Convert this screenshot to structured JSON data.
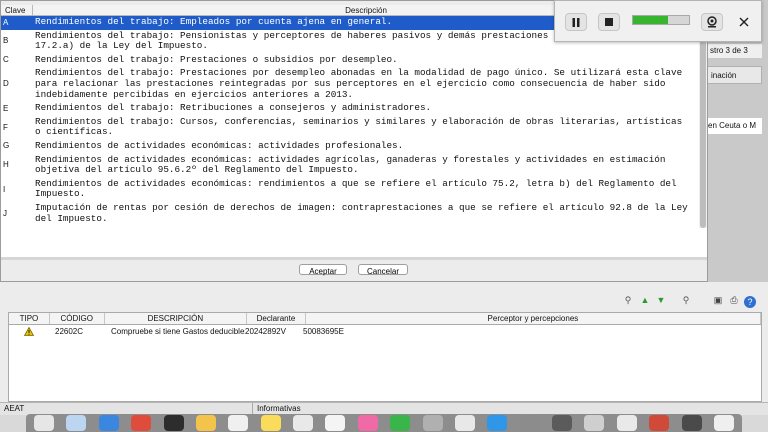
{
  "dialog": {
    "header": {
      "key": "Clave",
      "description": "Descripción"
    },
    "rows": [
      {
        "key": "A",
        "text": "Rendimientos del trabajo: Empleados por cuenta ajena en general.",
        "selected": true
      },
      {
        "key": "B",
        "text": "Rendimientos del trabajo: Pensionistas y perceptores de haberes pasivos y demás prestaciones previstas en el artículo 17.2.a) de la Ley del Impuesto."
      },
      {
        "key": "C",
        "text": "Rendimientos del trabajo: Prestaciones o subsidios por desempleo."
      },
      {
        "key": "D",
        "text": "Rendimientos del trabajo: Prestaciones por desempleo abonadas en la modalidad de pago único. Se utilizará esta clave para relacionar las prestaciones reintegradas por sus perceptores en el ejercicio como consecuencia de haber sido indebidamente percibidas en ejercicios anteriores a 2013."
      },
      {
        "key": "E",
        "text": "Rendimientos del trabajo: Retribuciones a consejeros y administradores."
      },
      {
        "key": "F",
        "text": "Rendimientos del trabajo: Cursos, conferencias, seminarios y similares y elaboración de obras literarias, artísticas o científicas."
      },
      {
        "key": "G",
        "text": "Rendimientos de actividades económicas: actividades profesionales."
      },
      {
        "key": "H",
        "text": "Rendimientos de actividades económicas: actividades agrícolas, ganaderas y forestales y actividades en estimación objetiva del artículo 95.6.2º del Reglamento del Impuesto."
      },
      {
        "key": "I",
        "text": "Rendimientos de actividades económicas: rendimientos a que se refiere el artículo 75.2, letra b) del Reglamento del Impuesto."
      },
      {
        "key": "J",
        "text": "Imputación de rentas por cesión de derechos de imagen: contraprestaciones a que se refiere el artículo 92.8 de la Ley del Impuesto."
      }
    ],
    "accept_label": "Aceptar",
    "cancel_label": "Cancelar"
  },
  "background": {
    "record_counter": "stro 3 de 3",
    "tab_label": "inación",
    "ceuta_text": "en Ceuta o M",
    "statusbar_left": "AEAT",
    "statusbar_center": "Informativas"
  },
  "results": {
    "columns": [
      "TIPO",
      "CÓDIGO",
      "DESCRIPCIÓN",
      "Declarante",
      "Perceptor y percepciones"
    ],
    "rows": [
      {
        "code": "22602C",
        "description": "Compruebe si tiene Gastos deducibles",
        "declarante": "20242892V",
        "perceptor": "50083695E"
      }
    ]
  },
  "recorder": {
    "volume_level": 0.62
  },
  "colors": {
    "selection": "#1f5cc9",
    "warning": "#e5c400",
    "volume": "#38b52f"
  }
}
